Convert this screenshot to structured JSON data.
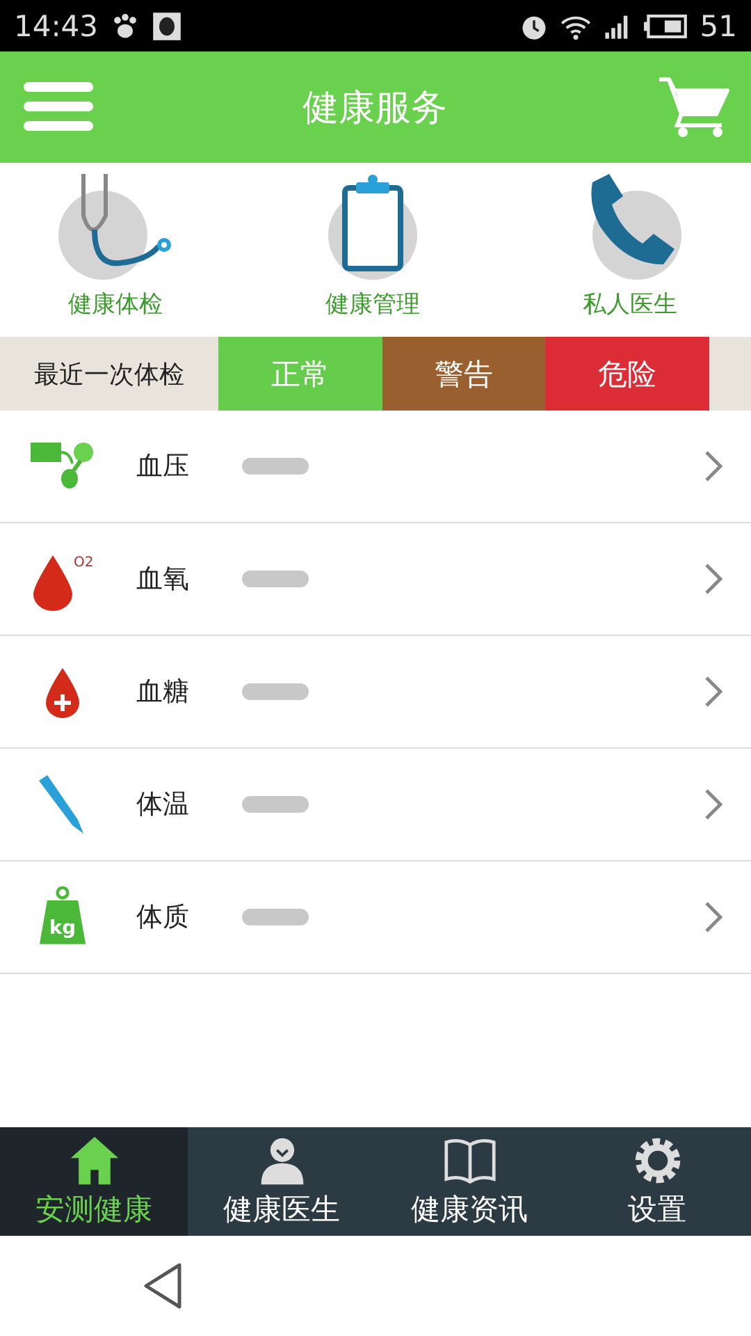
{
  "status_bar": {
    "time": "14:43",
    "battery": "51"
  },
  "header": {
    "title": "健康服务"
  },
  "shortcuts": [
    {
      "label": "健康体检",
      "kind": "stethoscope"
    },
    {
      "label": "健康管理",
      "kind": "clipboard"
    },
    {
      "label": "私人医生",
      "kind": "phone"
    }
  ],
  "legend": {
    "label": "最近一次体检",
    "levels": [
      {
        "label": "正常",
        "color": "#66cc4c"
      },
      {
        "label": "警告",
        "color": "#9a5f2e"
      },
      {
        "label": "危险",
        "color": "#dc2c36"
      }
    ]
  },
  "measures": [
    {
      "label": "血压",
      "kind": "pressure"
    },
    {
      "label": "血氧",
      "kind": "oxygen",
      "icon_text": "O2"
    },
    {
      "label": "血糖",
      "kind": "sugar"
    },
    {
      "label": "体温",
      "kind": "thermometer"
    },
    {
      "label": "体质",
      "kind": "weight",
      "icon_text": "kg"
    }
  ],
  "tabs": [
    {
      "label": "安测健康",
      "kind": "home",
      "selected": true
    },
    {
      "label": "健康医生",
      "kind": "doctor",
      "selected": false
    },
    {
      "label": "健康资讯",
      "kind": "book",
      "selected": false
    },
    {
      "label": "设置",
      "kind": "gear",
      "selected": false
    }
  ]
}
